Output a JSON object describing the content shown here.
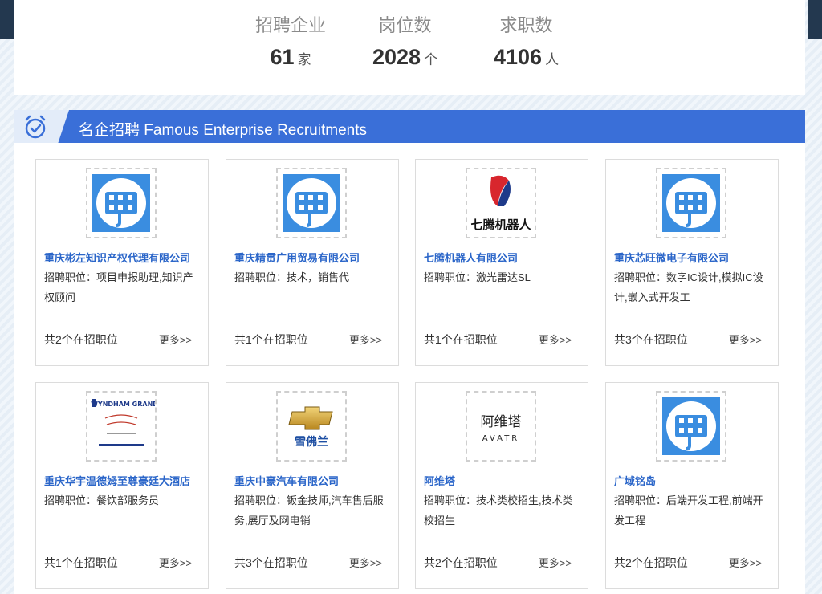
{
  "stats": [
    {
      "label": "招聘企业",
      "value": "61",
      "unit": "家"
    },
    {
      "label": "岗位数",
      "value": "2028",
      "unit": "个"
    },
    {
      "label": "求职数",
      "value": "4106",
      "unit": "人"
    }
  ],
  "section": {
    "title": "名企招聘 Famous Enterprise Recruitments",
    "icon": "alarm-clock-check-icon"
  },
  "cards": [
    {
      "company": "重庆彬左知识产权代理有限公司",
      "positions": "招聘职位：项目申报助理,知识产权顾问",
      "count": "共2个在招职位",
      "more": "更多>>",
      "logo": "pin-logo"
    },
    {
      "company": "重庆精贯广用贸易有限公司",
      "positions": "招聘职位：技术，销售代",
      "count": "共1个在招职位",
      "more": "更多>>",
      "logo": "pin-logo"
    },
    {
      "company": "七腾机器人有限公司",
      "positions": "招聘职位：激光雷达SL",
      "count": "共1个在招职位",
      "more": "更多>>",
      "logo": "qiteng-logo",
      "logo_text": "七腾机器人"
    },
    {
      "company": "重庆芯旺微电子有限公司",
      "positions": "招聘职位：数字IC设计,模拟IC设计,嵌入式开发工",
      "count": "共3个在招职位",
      "more": "更多>>",
      "logo": "pin-logo"
    },
    {
      "company": "重庆华宇温德姆至尊豪廷大酒店",
      "positions": "招聘职位：餐饮部服务员",
      "count": "共1个在招职位",
      "more": "更多>>",
      "logo": "wyndham-logo",
      "logo_text": "WYNDHAM GRAND"
    },
    {
      "company": "重庆中豪汽车有限公司",
      "positions": "招聘职位：钣金技师,汽车售后服务,展厅及网电销",
      "count": "共3个在招职位",
      "more": "更多>>",
      "logo": "chevrolet-logo",
      "logo_text": "雪佛兰"
    },
    {
      "company": "阿维塔",
      "positions": "招聘职位：技术类校招生,技术类校招生",
      "count": "共2个在招职位",
      "more": "更多>>",
      "logo": "avatr-logo",
      "logo_text": "阿维塔",
      "logo_subtext": "AVATR"
    },
    {
      "company": "广域铭岛",
      "positions": "招聘职位：后端开发工程,前端开发工程",
      "count": "共2个在招职位",
      "more": "更多>>",
      "logo": "pin-logo"
    }
  ]
}
